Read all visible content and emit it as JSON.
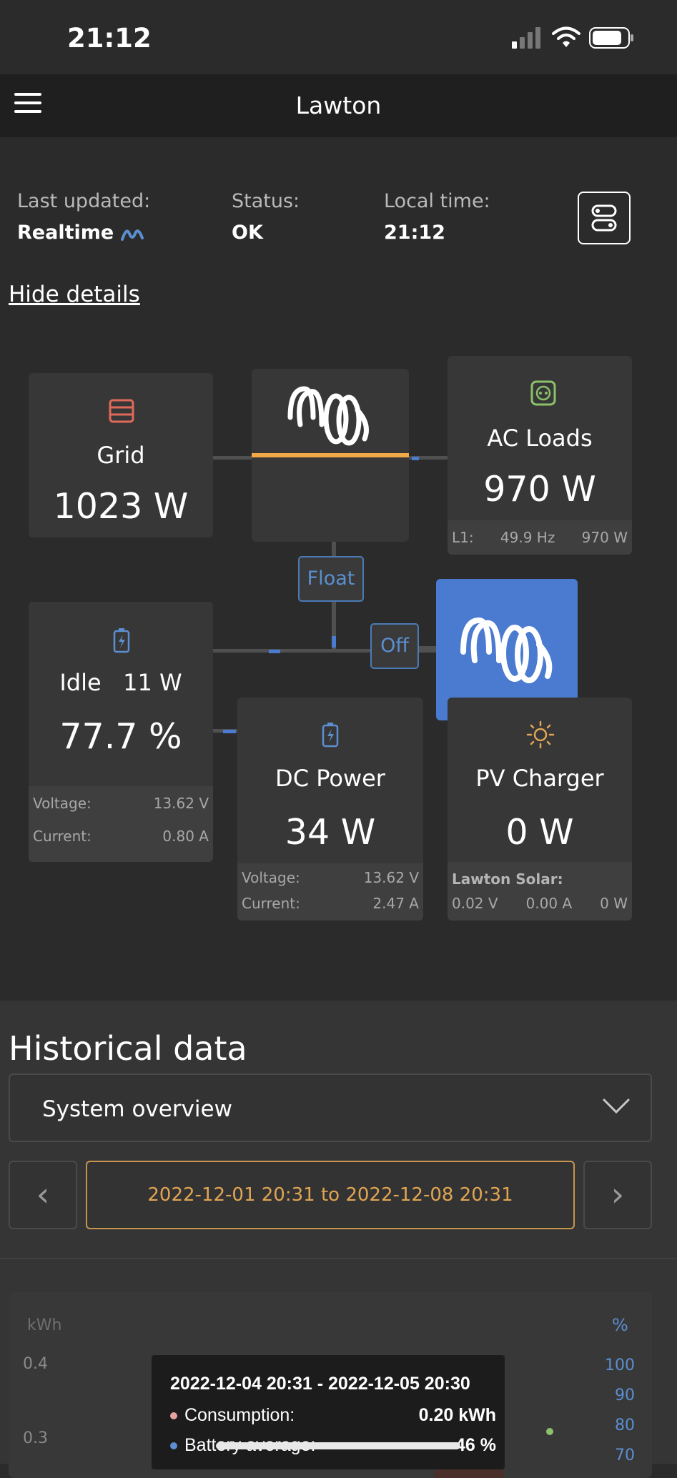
{
  "status_bar": {
    "time": "21:12"
  },
  "nav": {
    "title": "Lawton"
  },
  "info": {
    "last_updated_label": "Last updated:",
    "last_updated_value": "Realtime",
    "status_label": "Status:",
    "status_value": "OK",
    "local_time_label": "Local time:",
    "local_time_value": "21:12"
  },
  "hide_details": "Hide details",
  "grid": {
    "title": "Grid",
    "value": "1023 W"
  },
  "ac_loads": {
    "title": "AC Loads",
    "value": "970 W",
    "phase": "L1:",
    "freq": "49.9 Hz",
    "power": "970 W"
  },
  "inverter_state": "Float",
  "charger_state": "Off",
  "battery": {
    "state": "Idle",
    "power": "11 W",
    "soc": "77.7 %",
    "voltage_label": "Voltage:",
    "voltage": "13.62 V",
    "current_label": "Current:",
    "current": "0.80 A"
  },
  "dc_power": {
    "title": "DC Power",
    "value": "34 W",
    "voltage_label": "Voltage:",
    "voltage": "13.62 V",
    "current_label": "Current:",
    "current": "2.47 A"
  },
  "pv_charger": {
    "title": "PV Charger",
    "value": "0 W",
    "source_name": "Lawton Solar:",
    "voltage": "0.02 V",
    "current": "0.00 A",
    "power": "0 W"
  },
  "historical": {
    "title": "Historical data",
    "selected_view": "System overview",
    "date_range": "2022-12-01 20:31 to 2022-12-08 20:31",
    "prev_arrow": "‹",
    "next_arrow": "›"
  },
  "chart_data": {
    "type": "bar",
    "left_axis_label": "kWh",
    "right_axis_label": "%",
    "left_ticks": [
      "0.4",
      "0.3"
    ],
    "right_ticks": [
      "100",
      "90",
      "80",
      "70"
    ],
    "tooltip": {
      "title": "2022-12-04 20:31 - 2022-12-05 20:30",
      "rows": [
        {
          "label": "Consumption:",
          "value": "0.20 kWh",
          "color": "#e8a0a0"
        },
        {
          "label": "Battery average:",
          "value": "46 %",
          "color": "#5b8fd0"
        }
      ]
    }
  },
  "colors": {
    "accent_blue": "#4a7bd0",
    "accent_orange": "#e0a553",
    "grid_icon": "#e06a5a",
    "ac_icon": "#8cc06a"
  }
}
